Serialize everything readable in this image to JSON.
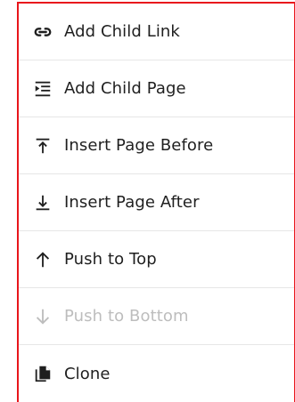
{
  "colors": {
    "frame": "#e8161c",
    "text": "#1f1f1f",
    "disabled_text": "#bdbdbd",
    "divider": "#e6e6e6"
  },
  "menu": {
    "items": [
      {
        "label": "Add Child Link",
        "icon": "link-icon",
        "disabled": false
      },
      {
        "label": "Add Child Page",
        "icon": "indent-list-icon",
        "disabled": false
      },
      {
        "label": "Insert Page Before",
        "icon": "arrow-up-to-line-icon",
        "disabled": false
      },
      {
        "label": "Insert Page After",
        "icon": "arrow-down-to-line-icon",
        "disabled": false
      },
      {
        "label": "Push to Top",
        "icon": "arrow-up-icon",
        "disabled": false
      },
      {
        "label": "Push to Bottom",
        "icon": "arrow-down-icon",
        "disabled": true
      },
      {
        "label": "Clone",
        "icon": "copy-icon",
        "disabled": false
      }
    ]
  }
}
